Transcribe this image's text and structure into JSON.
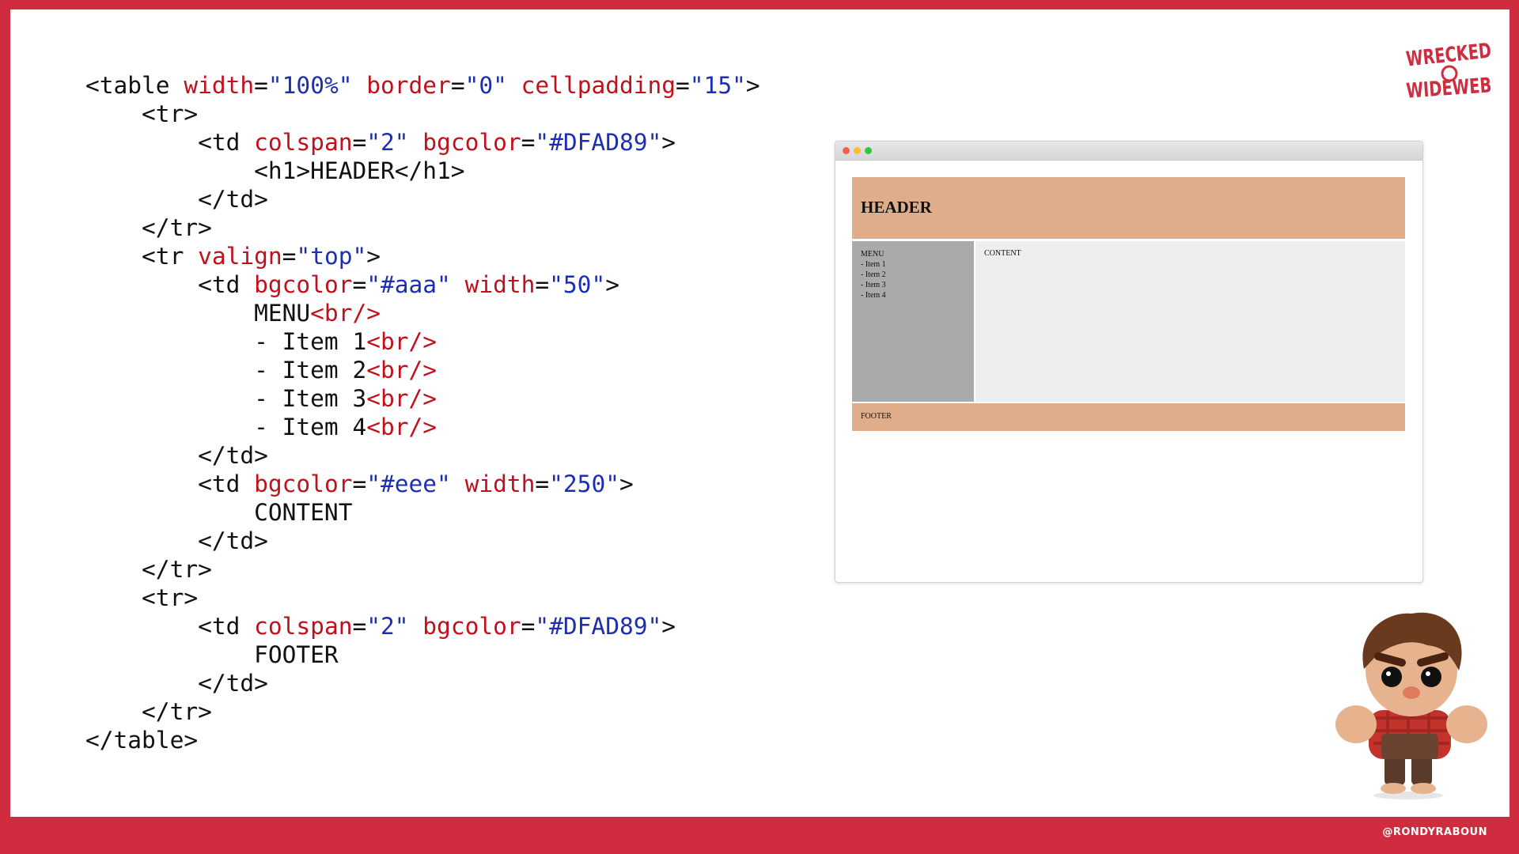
{
  "code": {
    "lines": [
      [
        {
          "t": "tag",
          "v": "<table "
        },
        {
          "t": "attr",
          "v": "width"
        },
        {
          "t": "eq",
          "v": "="
        },
        {
          "t": "val",
          "v": "\"100%\""
        },
        {
          "t": "tag",
          "v": " "
        },
        {
          "t": "attr",
          "v": "border"
        },
        {
          "t": "eq",
          "v": "="
        },
        {
          "t": "val",
          "v": "\"0\""
        },
        {
          "t": "tag",
          "v": " "
        },
        {
          "t": "attr",
          "v": "cellpadding"
        },
        {
          "t": "eq",
          "v": "="
        },
        {
          "t": "val",
          "v": "\"15\""
        },
        {
          "t": "tag",
          "v": ">"
        }
      ],
      [
        {
          "t": "tag",
          "v": "    <tr>"
        }
      ],
      [
        {
          "t": "tag",
          "v": "        <td "
        },
        {
          "t": "attr",
          "v": "colspan"
        },
        {
          "t": "eq",
          "v": "="
        },
        {
          "t": "val",
          "v": "\"2\""
        },
        {
          "t": "tag",
          "v": " "
        },
        {
          "t": "attr",
          "v": "bgcolor"
        },
        {
          "t": "eq",
          "v": "="
        },
        {
          "t": "val",
          "v": "\"#DFAD89\""
        },
        {
          "t": "tag",
          "v": ">"
        }
      ],
      [
        {
          "t": "tag",
          "v": "            <h1>"
        },
        {
          "t": "text",
          "v": "HEADER"
        },
        {
          "t": "tag",
          "v": "</h1>"
        }
      ],
      [
        {
          "t": "tag",
          "v": "        </td>"
        }
      ],
      [
        {
          "t": "tag",
          "v": "    </tr>"
        }
      ],
      [
        {
          "t": "tag",
          "v": "    <tr "
        },
        {
          "t": "attr",
          "v": "valign"
        },
        {
          "t": "eq",
          "v": "="
        },
        {
          "t": "val",
          "v": "\"top\""
        },
        {
          "t": "tag",
          "v": ">"
        }
      ],
      [
        {
          "t": "tag",
          "v": "        <td "
        },
        {
          "t": "attr",
          "v": "bgcolor"
        },
        {
          "t": "eq",
          "v": "="
        },
        {
          "t": "val",
          "v": "\"#aaa\""
        },
        {
          "t": "tag",
          "v": " "
        },
        {
          "t": "attr",
          "v": "width"
        },
        {
          "t": "eq",
          "v": "="
        },
        {
          "t": "val",
          "v": "\"50\""
        },
        {
          "t": "tag",
          "v": ">"
        }
      ],
      [
        {
          "t": "text",
          "v": "            MENU"
        },
        {
          "t": "attr",
          "v": "<br/>"
        }
      ],
      [
        {
          "t": "text",
          "v": "            - Item 1"
        },
        {
          "t": "attr",
          "v": "<br/>"
        }
      ],
      [
        {
          "t": "text",
          "v": "            - Item 2"
        },
        {
          "t": "attr",
          "v": "<br/>"
        }
      ],
      [
        {
          "t": "text",
          "v": "            - Item 3"
        },
        {
          "t": "attr",
          "v": "<br/>"
        }
      ],
      [
        {
          "t": "text",
          "v": "            - Item 4"
        },
        {
          "t": "attr",
          "v": "<br/>"
        }
      ],
      [
        {
          "t": "tag",
          "v": "        </td>"
        }
      ],
      [
        {
          "t": "tag",
          "v": "        <td "
        },
        {
          "t": "attr",
          "v": "bgcolor"
        },
        {
          "t": "eq",
          "v": "="
        },
        {
          "t": "val",
          "v": "\"#eee\""
        },
        {
          "t": "tag",
          "v": " "
        },
        {
          "t": "attr",
          "v": "width"
        },
        {
          "t": "eq",
          "v": "="
        },
        {
          "t": "val",
          "v": "\"250\""
        },
        {
          "t": "tag",
          "v": ">"
        }
      ],
      [
        {
          "t": "text",
          "v": "            CONTENT"
        }
      ],
      [
        {
          "t": "tag",
          "v": "        </td>"
        }
      ],
      [
        {
          "t": "tag",
          "v": "    </tr>"
        }
      ],
      [
        {
          "t": "tag",
          "v": "    <tr>"
        }
      ],
      [
        {
          "t": "tag",
          "v": "        <td "
        },
        {
          "t": "attr",
          "v": "colspan"
        },
        {
          "t": "eq",
          "v": "="
        },
        {
          "t": "val",
          "v": "\"2\""
        },
        {
          "t": "tag",
          "v": " "
        },
        {
          "t": "attr",
          "v": "bgcolor"
        },
        {
          "t": "eq",
          "v": "="
        },
        {
          "t": "val",
          "v": "\"#DFAD89\""
        },
        {
          "t": "tag",
          "v": ">"
        }
      ],
      [
        {
          "t": "text",
          "v": "            FOOTER"
        }
      ],
      [
        {
          "t": "tag",
          "v": "        </td>"
        }
      ],
      [
        {
          "t": "tag",
          "v": "    </tr>"
        }
      ],
      [
        {
          "t": "tag",
          "v": "</table>"
        }
      ]
    ]
  },
  "browser": {
    "header_text": "HEADER",
    "menu_title": "MENU",
    "menu_items": [
      "- Item 1",
      "- Item 2",
      "- Item 3",
      "- Item 4"
    ],
    "content_text": "CONTENT",
    "footer_text": "FOOTER"
  },
  "logo": {
    "line1": "WRECKED",
    "line2": "WIDEWEB"
  },
  "footer": {
    "handle": "@RONDYRABOUN"
  },
  "colors": {
    "frame": "#cf2d3f",
    "attr": "#c0101c",
    "value": "#1d2fb0",
    "header_bg": "#DFAD89",
    "menu_bg": "#aaaaaa",
    "content_bg": "#eeeeee"
  },
  "icons": [
    "window-close-dot",
    "window-minimize-dot",
    "window-zoom-dot",
    "wreck-it-ralph-figure",
    "wrecked-wide-web-logo"
  ]
}
